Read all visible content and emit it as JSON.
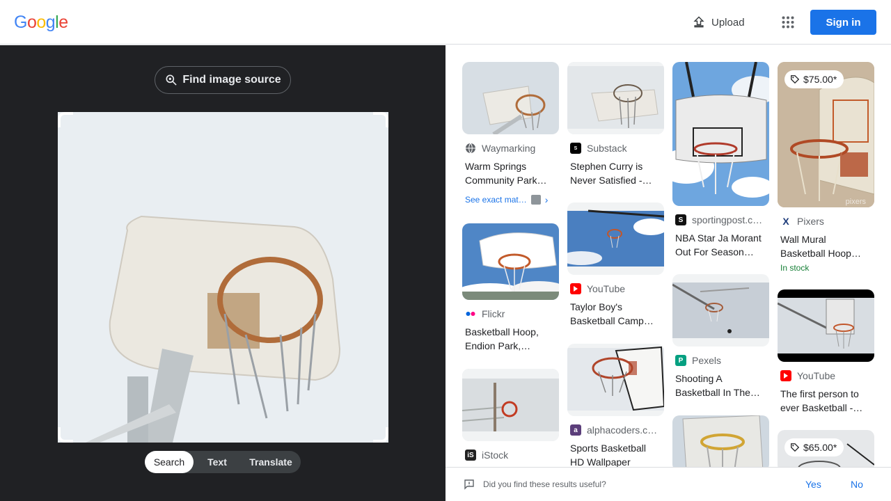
{
  "header": {
    "logo": [
      "G",
      "o",
      "o",
      "g",
      "l",
      "e"
    ],
    "upload_label": "Upload",
    "signin_label": "Sign in"
  },
  "left": {
    "find_source_label": "Find image source",
    "modes": [
      "Search",
      "Text",
      "Translate"
    ],
    "active_mode": "Search"
  },
  "results": [
    {
      "source": "Waymarking",
      "title": "Warm Springs Community Park…",
      "icon": "globe-icon",
      "extra": "See exact mat…"
    },
    {
      "source": "Substack",
      "title": "Stephen Curry is Never Satisfied -…",
      "icon": "substack-icon"
    },
    {
      "source": "sportingpost.c…",
      "title": "NBA Star Ja Morant Out For Season…",
      "icon": "sportingpost-icon"
    },
    {
      "source": "Pixers",
      "title": "Wall Mural Basketball Hoop…",
      "icon": "pixers-icon",
      "price": "$75.00*",
      "stock": "In stock",
      "watermark": "pixers"
    },
    {
      "source": "Flickr",
      "title": "Basketball Hoop, Endion Park,…",
      "icon": "flickr-icon"
    },
    {
      "source": "YouTube",
      "title": "Taylor Boy's Basketball Camp…",
      "icon": "youtube-icon"
    },
    {
      "source": "Pexels",
      "title": "Shooting A Basketball In The…",
      "icon": "pexels-icon"
    },
    {
      "source": "YouTube",
      "title": "The first person to ever Basketball -…",
      "icon": "youtube-icon"
    },
    {
      "source": "iStock",
      "title": "",
      "icon": "istock-icon"
    },
    {
      "source": "alphacoders.c…",
      "title": "Sports Basketball HD Wallpaper",
      "icon": "alphacoders-icon"
    },
    {
      "source": "",
      "title": "",
      "icon": ""
    },
    {
      "source": "",
      "title": "",
      "icon": "",
      "price": "$65.00*"
    }
  ],
  "footer": {
    "question": "Did you find these results useful?",
    "yes": "Yes",
    "no": "No"
  },
  "colors": {
    "google_blue": "#4285F4",
    "google_red": "#EA4335",
    "google_yellow": "#FBBC05",
    "google_green": "#34A853",
    "accent": "#1a73e8",
    "dark_panel": "#202124"
  }
}
